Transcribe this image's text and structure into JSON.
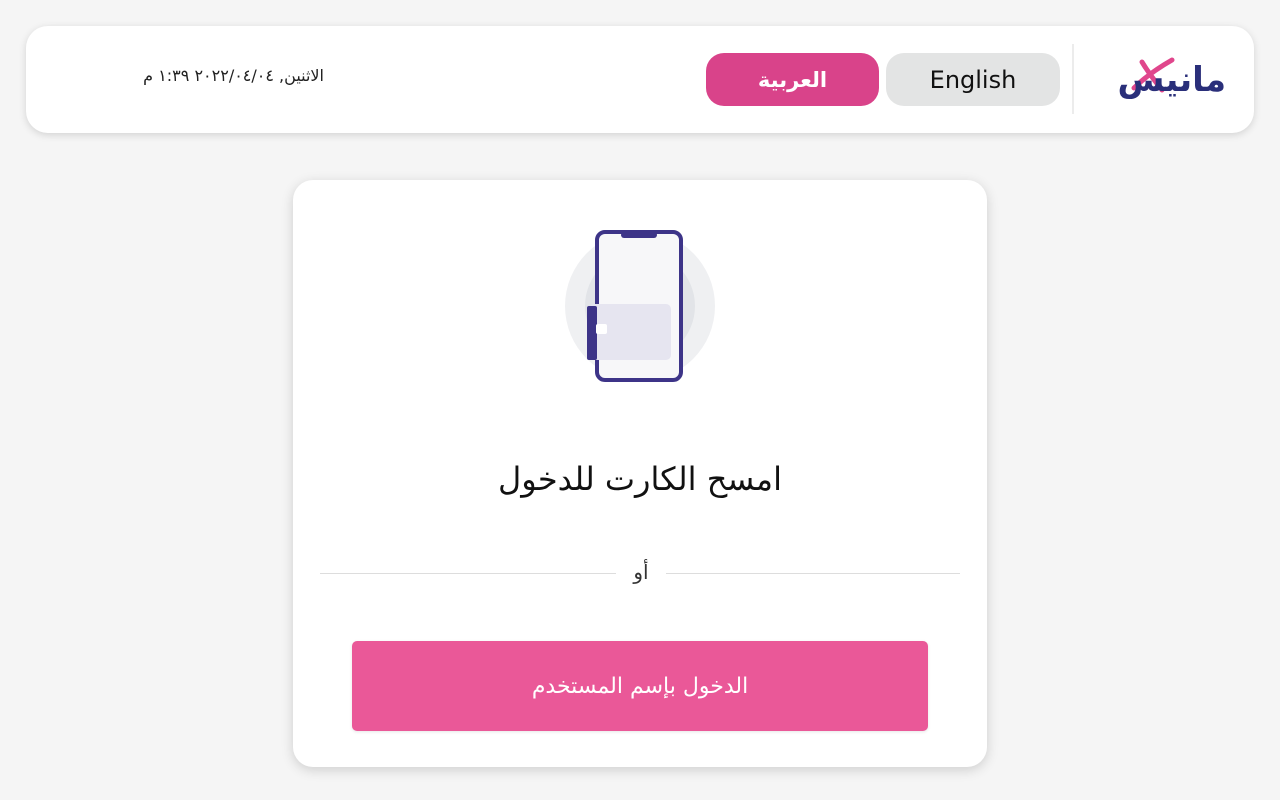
{
  "header": {
    "logo_text": "مانيس",
    "lang_english": "English",
    "lang_arabic": "العربية",
    "datetime": "الاثنين, ٢٠٢٢/٠٤/٠٤ ١:٣٩ م"
  },
  "card": {
    "icon": "phone-card-scan-icon",
    "scan_title": "امسح الكارت للدخول",
    "or_text": "أو",
    "login_button": "الدخول بإسم المستخدم"
  },
  "colors": {
    "brand_navy": "#2a2f7a",
    "brand_pink": "#d9438a",
    "button_pink": "#ea5898",
    "phone_outline": "#3d3488"
  }
}
